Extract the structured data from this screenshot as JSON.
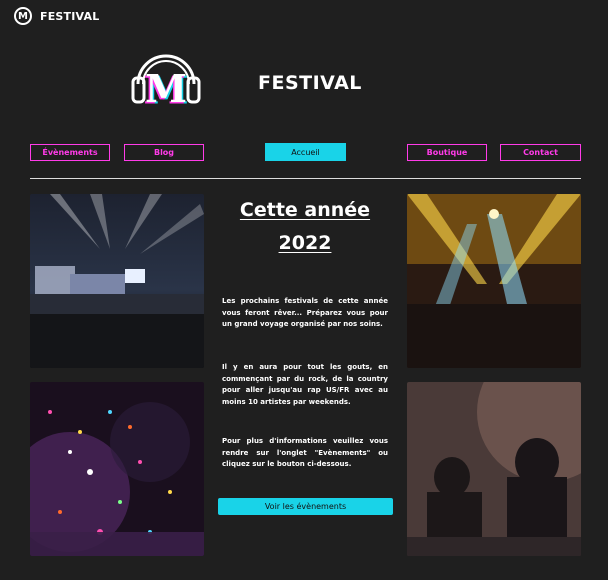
{
  "topbar": {
    "title": "FESTIVAL",
    "logo_letter": "M"
  },
  "header": {
    "brand": "FESTIVAL",
    "logo_letter": "M"
  },
  "nav": {
    "items": [
      "Évènements",
      "Blog",
      "Accueil",
      "Boutique",
      "Contact"
    ],
    "active": "Accueil"
  },
  "main": {
    "heading_line1": "Cette année",
    "heading_line2": "2022",
    "paragraphs": [
      "Les prochains festivals de cette année vous feront rêver... Préparez vous pour un grand voyage organisé par nos soins.",
      "Il y en aura pour tout les gouts, en commençant par du rock, de la country pour aller jusqu'au rap US/FR avec au moins 10 artistes par weekends.",
      "Pour plus d'informations veuillez vous rendre sur l'onglet \"Evènements\" ou cliquez sur le bouton ci-dessous."
    ],
    "cta_label": "Voir les évènements"
  },
  "colors": {
    "background": "#1f1f1f",
    "accent_pink": "#ff3be8",
    "accent_cyan": "#19d3e8"
  },
  "icons": [
    "headphones-logo-icon"
  ]
}
